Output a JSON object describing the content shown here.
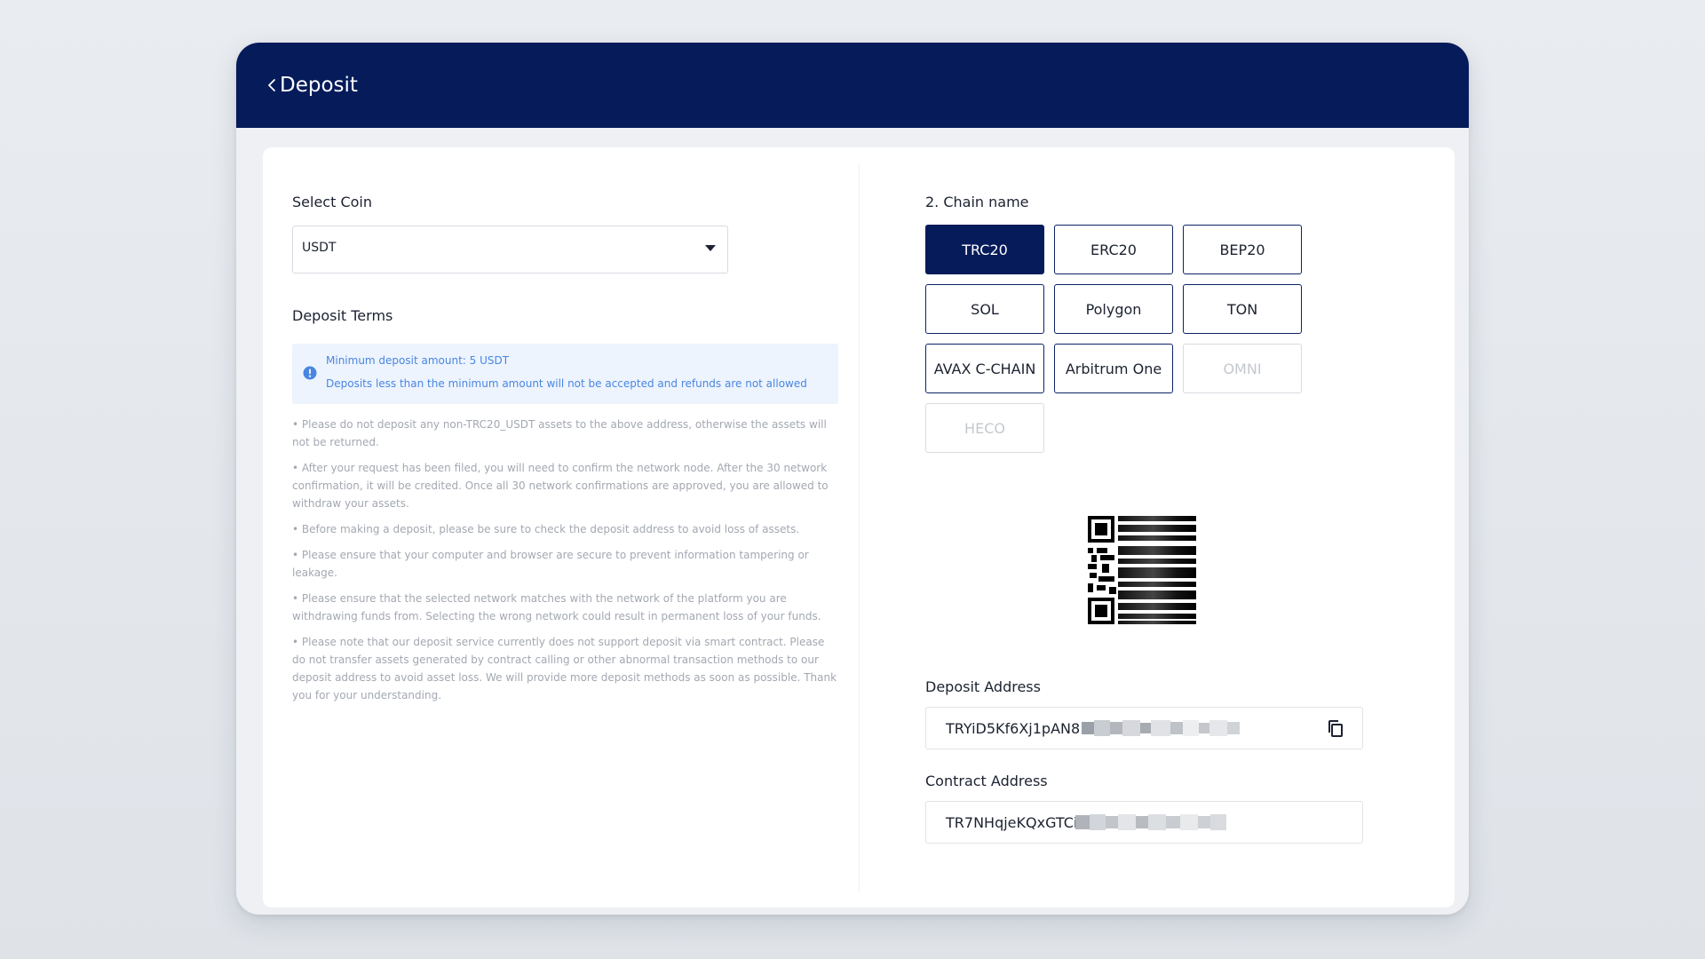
{
  "header": {
    "title": "Deposit"
  },
  "select_coin": {
    "label": "Select Coin",
    "value": "USDT"
  },
  "deposit_terms": {
    "title": "Deposit Terms",
    "notice": {
      "line1": "Minimum deposit amount: 5 USDT",
      "line2": "Deposits less than the minimum amount will not be accepted and refunds are not allowed"
    },
    "items": [
      "• Please do not deposit any non-TRC20_USDT assets to the above address, otherwise the assets will not be returned.",
      "• After your request has been filed, you will need to confirm the network node. After the 30 network confirmation, it will be credited. Once all 30 network confirmations are approved, you are allowed to withdraw your assets.",
      "• Before making a deposit, please be sure to check the deposit address to avoid loss of assets.",
      "• Please ensure that your computer and browser are secure to prevent information tampering or leakage.",
      "• Please ensure that the selected network matches with the network of the platform you are withdrawing funds from. Selecting the wrong network could result in permanent loss of your funds.",
      "• Please note that our deposit service currently does not support deposit via smart contract. Please do not transfer assets generated by contract calling or other abnormal transaction methods to our deposit address to avoid asset loss. We will provide more deposit methods as soon as possible. Thank you for your understanding."
    ]
  },
  "chain": {
    "label": "2. Chain name",
    "options": [
      {
        "label": "TRC20",
        "state": "selected"
      },
      {
        "label": "ERC20",
        "state": "enabled"
      },
      {
        "label": "BEP20",
        "state": "enabled"
      },
      {
        "label": "SOL",
        "state": "enabled"
      },
      {
        "label": "Polygon",
        "state": "enabled"
      },
      {
        "label": "TON",
        "state": "enabled"
      },
      {
        "label": "AVAX C-CHAIN",
        "state": "enabled"
      },
      {
        "label": "Arbitrum One",
        "state": "enabled"
      },
      {
        "label": "OMNI",
        "state": "disabled"
      },
      {
        "label": "HECO",
        "state": "disabled"
      }
    ]
  },
  "deposit_address": {
    "label": "Deposit Address",
    "value_visible": "TRYiD5Kf6Xj1pAN8"
  },
  "contract_address": {
    "label": "Contract Address",
    "value_visible": "TR7NHqjeKQxGTCi"
  },
  "icons": {
    "back": "chevron-left-icon",
    "dropdown": "caret-down-icon",
    "info": "info-circle-icon",
    "copy": "copy-icon"
  },
  "colors": {
    "brand_navy": "#051b5a",
    "info_blue": "#4a86e0",
    "info_bg": "#edf4fe",
    "muted_text": "#a3a8b1"
  }
}
